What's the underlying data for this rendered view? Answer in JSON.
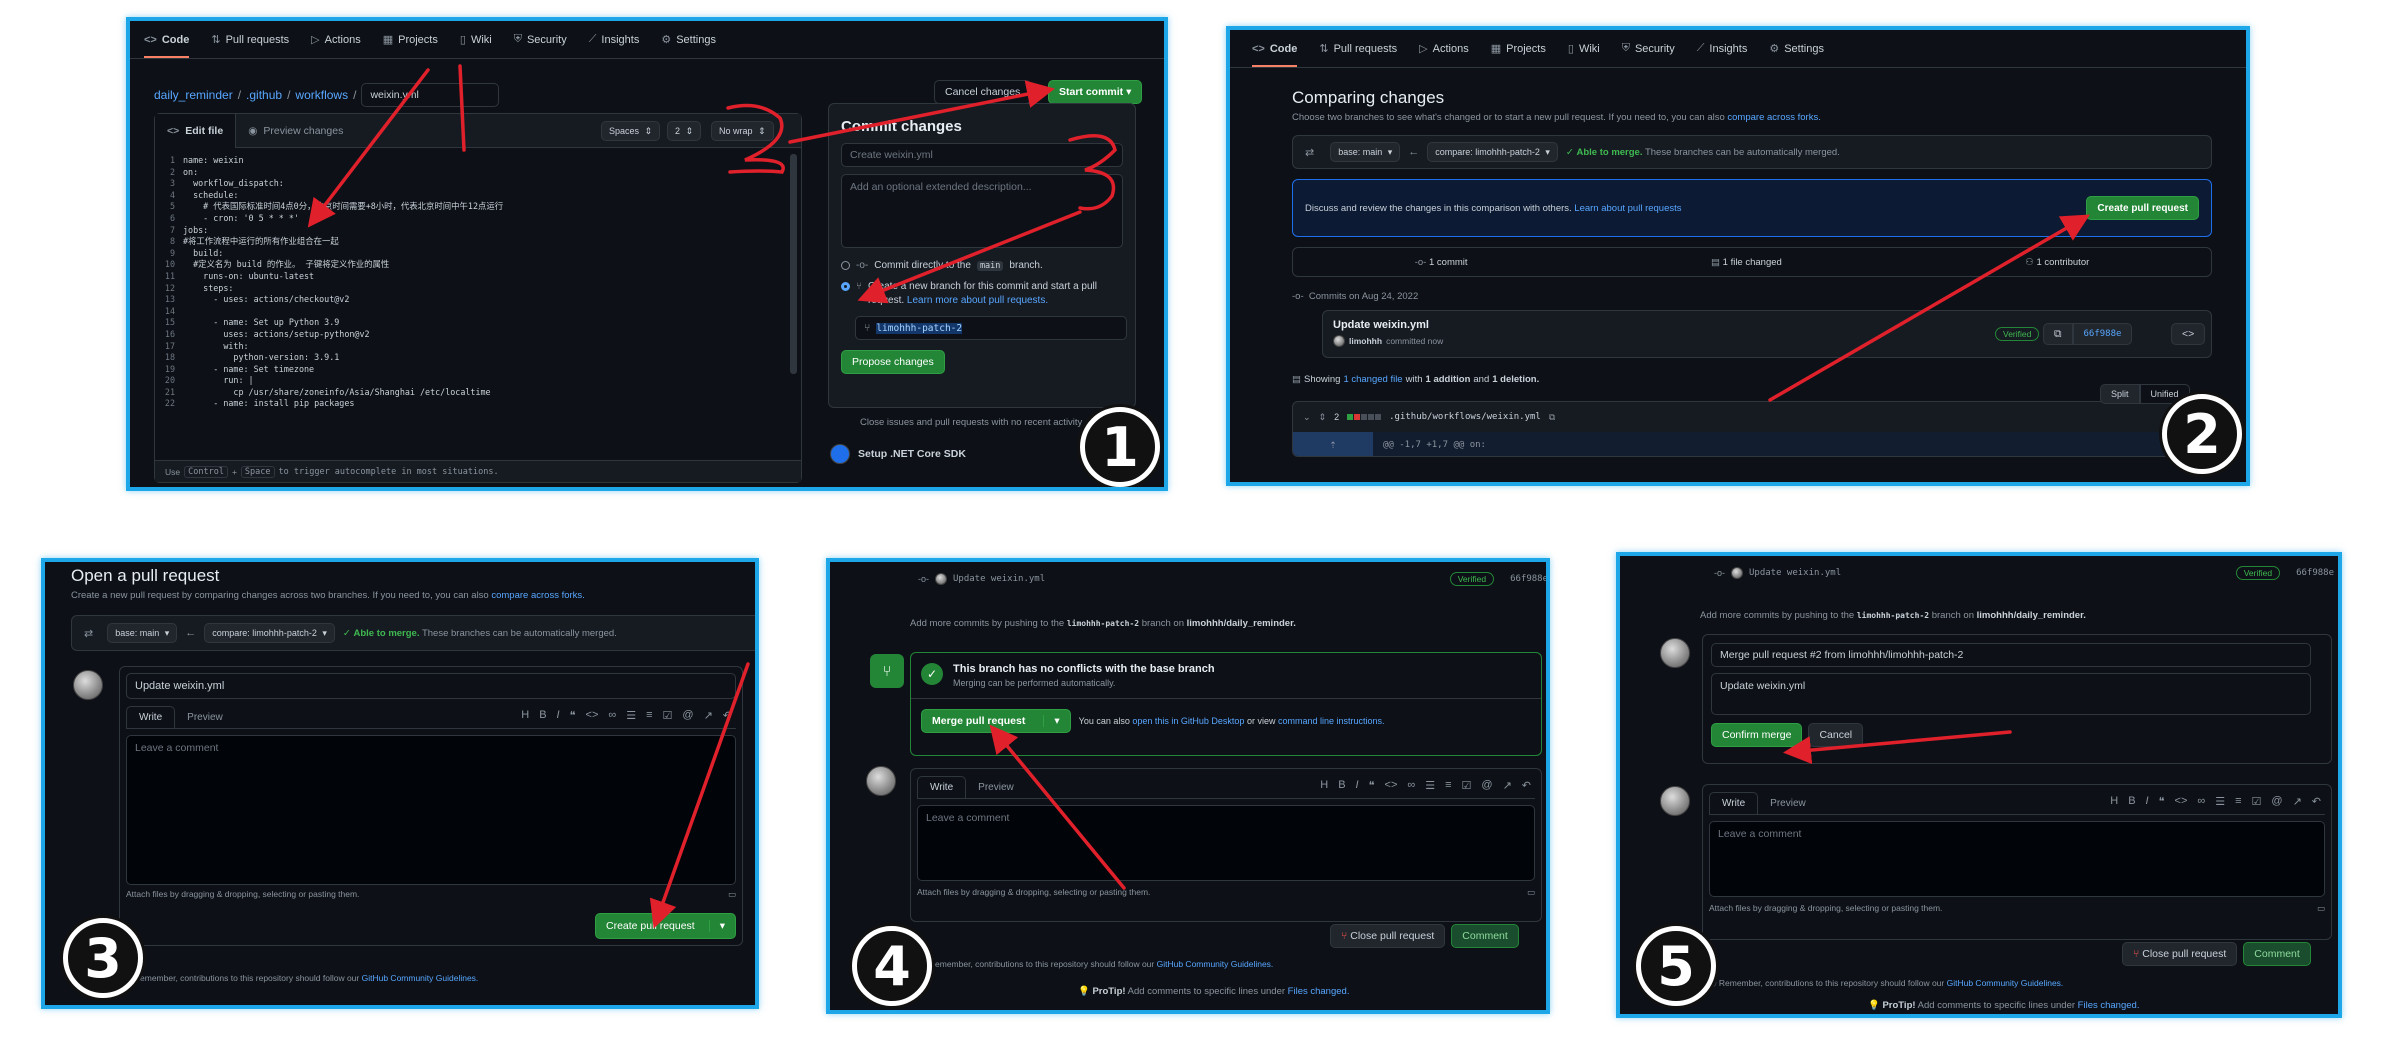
{
  "repo_tabs": [
    "Code",
    "Pull requests",
    "Actions",
    "Projects",
    "Wiki",
    "Security",
    "Insights",
    "Settings"
  ],
  "step_numbers": [
    "1",
    "2",
    "3",
    "4",
    "5"
  ],
  "colors": {
    "frame": "#1ea7e8",
    "annot": "#e0202a",
    "bg": "#0d1117",
    "green": "#238636",
    "link": "#58a6ff"
  },
  "p1": {
    "breadcrumb": {
      "repo": "daily_reminder",
      "dir1": ".github",
      "dir2": "workflows",
      "sep": "/",
      "file": "weixin.yml"
    },
    "cancel": "Cancel changes",
    "start": "Start commit",
    "edit_tab": "Edit file",
    "preview_tab": "Preview changes",
    "indent_mode": "Spaces",
    "indent_size": "2",
    "wrap": "No wrap",
    "code": [
      {
        "n": "1",
        "t": "name: weixin"
      },
      {
        "n": "2",
        "t": "on:"
      },
      {
        "n": "3",
        "t": "  workflow_dispatch:"
      },
      {
        "n": "4",
        "t": "  schedule:"
      },
      {
        "n": "5",
        "t": "    # 代表国际标准时间4点0分，北京时间需要+8小时，代表北京时间中午12点运行"
      },
      {
        "n": "6",
        "t": "    - cron: '0 5 * * *'"
      },
      {
        "n": "7",
        "t": "jobs:"
      },
      {
        "n": "8",
        "t": "#将工作流程中运行的所有作业组合在一起"
      },
      {
        "n": "9",
        "t": "  build:"
      },
      {
        "n": "10",
        "t": "  #定义名为 build 的作业。 子键将定义作业的属性"
      },
      {
        "n": "11",
        "t": "    runs-on: ubuntu-latest"
      },
      {
        "n": "12",
        "t": "    steps:"
      },
      {
        "n": "13",
        "t": "      - uses: actions/checkout@v2"
      },
      {
        "n": "14",
        "t": ""
      },
      {
        "n": "15",
        "t": "      - name: Set up Python 3.9"
      },
      {
        "n": "16",
        "t": "        uses: actions/setup-python@v2"
      },
      {
        "n": "17",
        "t": "        with:"
      },
      {
        "n": "18",
        "t": "          python-version: 3.9.1"
      },
      {
        "n": "19",
        "t": "      - name: Set timezone"
      },
      {
        "n": "20",
        "t": "        run: |"
      },
      {
        "n": "21",
        "t": "          cp /usr/share/zoneinfo/Asia/Shanghai /etc/localtime"
      },
      {
        "n": "22",
        "t": "      - name: install pip packages"
      }
    ],
    "footer": {
      "use": "Use",
      "control": "Control",
      "plus": "+",
      "space": "Space",
      "rest": "to trigger autocomplete in most situations."
    },
    "commit": {
      "title": "Commit changes",
      "summary_ph": "Create weixin.yml",
      "desc_ph": "Add an optional extended description...",
      "opt1_a": "Commit directly to the",
      "opt1_branch": "main",
      "opt1_b": "branch.",
      "opt2": "Create a new branch for this commit and start a pull request.",
      "opt2_link": "Learn more about pull requests.",
      "branch": "limohhh-patch-2",
      "propose": "Propose changes"
    },
    "behind": {
      "line1": "Close issues and pull requests with no recent activity",
      "setup": "Setup .NET Core SDK"
    }
  },
  "p2": {
    "title": "Comparing changes",
    "subtitle": "Choose two branches to see what's changed or to start a new pull request. If you need to, you can also",
    "subtitle_link": "compare across forks.",
    "base": "base: main",
    "compare": "compare: limohhh-patch-2",
    "able": "Able to merge.",
    "able_rest": "These branches can be automatically merged.",
    "discuss": "Discuss and review the changes in this comparison with others.",
    "discuss_link": "Learn about pull requests",
    "create_pr": "Create pull request",
    "stats": [
      "1 commit",
      "1 file changed",
      "1 contributor"
    ],
    "commits_on": "Commits on Aug 24, 2022",
    "commit_title": "Update weixin.yml",
    "commit_author": "limohhh",
    "commit_when": "committed now",
    "verified": "Verified",
    "sha": "66f988e",
    "showing_a": "Showing",
    "showing_link": "1 changed file",
    "showing_b": "with",
    "add": "1 addition",
    "and": "and",
    "del": "1 deletion.",
    "split": "Split",
    "unified": "Unified",
    "file_count": "2",
    "file_path": ".github/workflows/weixin.yml",
    "hunk": "@@ -1,7 +1,7 @@ on:"
  },
  "p3": {
    "title": "Open a pull request",
    "subtitle": "Create a new pull request by comparing changes across two branches. If you need to, you can also",
    "subtitle_link": "compare across forks.",
    "base": "base: main",
    "compare": "compare: limohhh-patch-2",
    "able": "Able to merge.",
    "able_rest": "These branches can be automatically merged.",
    "pr_title": "Update weixin.yml",
    "write": "Write",
    "preview": "Preview",
    "comment_ph": "Leave a comment",
    "attach": "Attach files by dragging & dropping, selecting or pasting them.",
    "create": "Create pull request",
    "remember": "Remember, contributions to this repository should follow our",
    "guidelines": "GitHub Community Guidelines."
  },
  "p4": {
    "commit_title": "Update weixin.yml",
    "verified": "Verified",
    "sha": "66f988e",
    "more_a": "Add more commits by pushing to the",
    "more_branch": "limohhh-patch-2",
    "more_b": "branch on",
    "more_repo": "limohhh/daily_reminder.",
    "no_conflicts": "This branch has no conflicts with the base branch",
    "auto": "Merging can be performed automatically.",
    "merge": "Merge pull request",
    "also_a": "You can also",
    "also_link1": "open this in GitHub Desktop",
    "also_b": "or view",
    "also_link2": "command line instructions.",
    "write": "Write",
    "preview": "Preview",
    "comment_ph": "Leave a comment",
    "attach": "Attach files by dragging & dropping, selecting or pasting them.",
    "close": "Close pull request",
    "comment": "Comment",
    "remember": "Remember, contributions to this repository should follow our",
    "guidelines": "GitHub Community Guidelines.",
    "protip": "ProTip!",
    "protip_rest": "Add comments to specific lines under",
    "protip_link": "Files changed."
  },
  "p5": {
    "commit_title": "Update weixin.yml",
    "verified": "Verified",
    "sha": "66f988e",
    "more_a": "Add more commits by pushing to the",
    "more_branch": "limohhh-patch-2",
    "more_b": "branch on",
    "more_repo": "limohhh/daily_reminder.",
    "merge_title": "Merge pull request #2 from limohhh/limohhh-patch-2",
    "merge_body": "Update weixin.yml",
    "confirm": "Confirm merge",
    "cancel": "Cancel",
    "write": "Write",
    "preview": "Preview",
    "comment_ph": "Leave a comment",
    "attach": "Attach files by dragging & dropping, selecting or pasting them.",
    "close": "Close pull request",
    "comment": "Comment",
    "remember": "Remember, contributions to this repository should follow our",
    "guidelines": "GitHub Community Guidelines.",
    "protip": "ProTip!",
    "protip_rest": "Add comments to specific lines under",
    "protip_link": "Files changed."
  }
}
